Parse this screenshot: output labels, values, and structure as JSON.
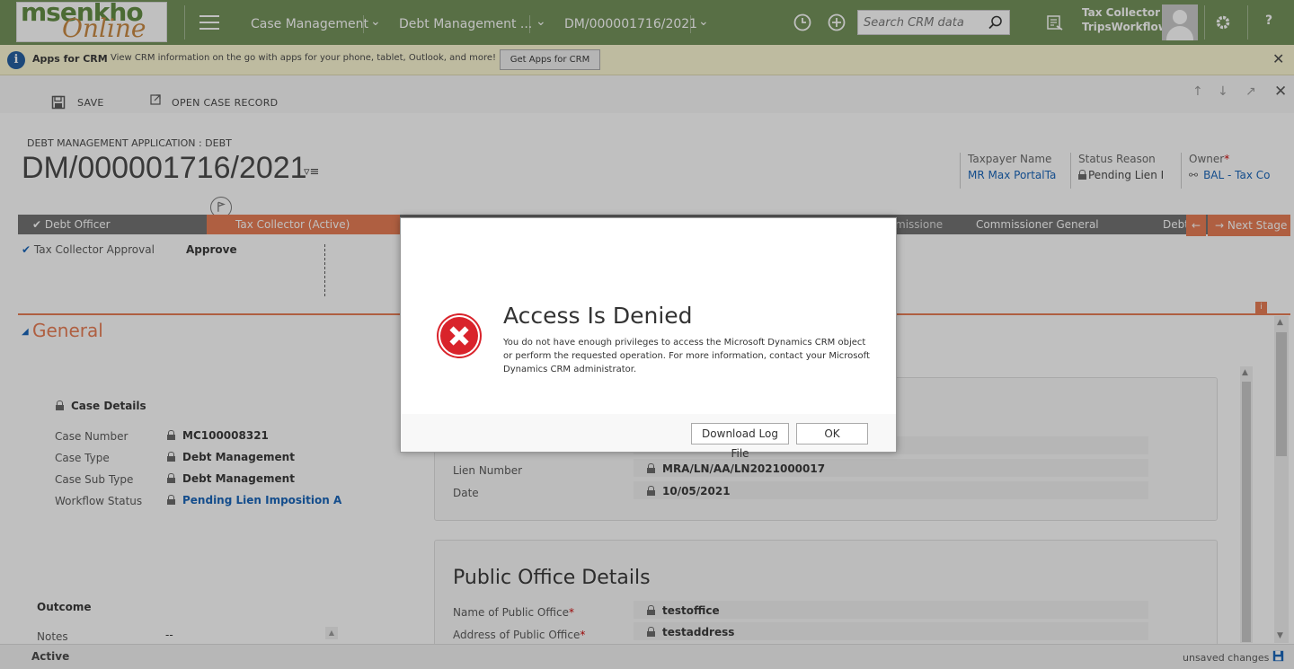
{
  "nav": {
    "logo_part1": "msenkho",
    "logo_part2": "Online",
    "items": [
      "Case Management",
      "Debt Management ...",
      "DM/000001716/2021"
    ],
    "search_placeholder": "Search CRM data",
    "user_line1": "Tax Collector",
    "user_line2": "TripsWorkflow",
    "help": "?"
  },
  "infobar": {
    "title": "Apps for CRM",
    "text": "View CRM information on the go with apps for your phone, tablet, Outlook, and more!",
    "button": "Get Apps for CRM"
  },
  "commands": {
    "save": "SAVE",
    "open_case": "OPEN CASE RECORD"
  },
  "header": {
    "entity_type": "DEBT MANAGEMENT APPLICATION : DEBT",
    "title": "DM/000001716/2021",
    "fields": [
      {
        "label": "Taxpayer Name",
        "value": "MR Max PortalTa"
      },
      {
        "label": "Status Reason",
        "value": "Pending Lien I"
      },
      {
        "label": "Owner",
        "value": "BAL - Tax Co"
      }
    ]
  },
  "process": {
    "stages": [
      "Debt Officer",
      "Tax Collector (Active)",
      "Commissioner General",
      "Debt"
    ],
    "partial_stage": "missione",
    "next_stage": "Next Stage",
    "step_label": "Tax Collector Approval",
    "step_value": "Approve"
  },
  "general": {
    "section_title": "General",
    "case_details_header": "Case Details",
    "fields": [
      {
        "label": "Case Number",
        "value": "MC100008321"
      },
      {
        "label": "Case Type",
        "value": "Debt Management"
      },
      {
        "label": "Case Sub Type",
        "value": "Debt Management"
      },
      {
        "label": "Workflow Status",
        "value": "Pending Lien Imposition A"
      }
    ],
    "lien_fields": [
      {
        "label": "Lien Number",
        "value": "MRA/LN/AA/LN2021000017"
      },
      {
        "label": "Date",
        "value": "10/05/2021"
      }
    ],
    "public_office_title": "Public Office Details",
    "public_office_fields": [
      {
        "label": "Name of Public Office",
        "value": "testoffice"
      },
      {
        "label": "Address of Public Office",
        "value": "testaddress"
      }
    ],
    "outcome_header": "Outcome",
    "notes_label": "Notes",
    "notes_value": "--"
  },
  "footer": {
    "status": "Active",
    "unsaved": "unsaved changes"
  },
  "dialog": {
    "title": "Access Is Denied",
    "message": "You do not have enough privileges to access the Microsoft Dynamics CRM object or perform the requested operation. For more information, contact your Microsoft Dynamics CRM administrator.",
    "download_button": "Download Log File",
    "ok_button": "OK"
  },
  "colors": {
    "nav_bg": "#6f8f55",
    "accent": "#e8794f",
    "link": "#1160b7",
    "error": "#d9232b"
  }
}
